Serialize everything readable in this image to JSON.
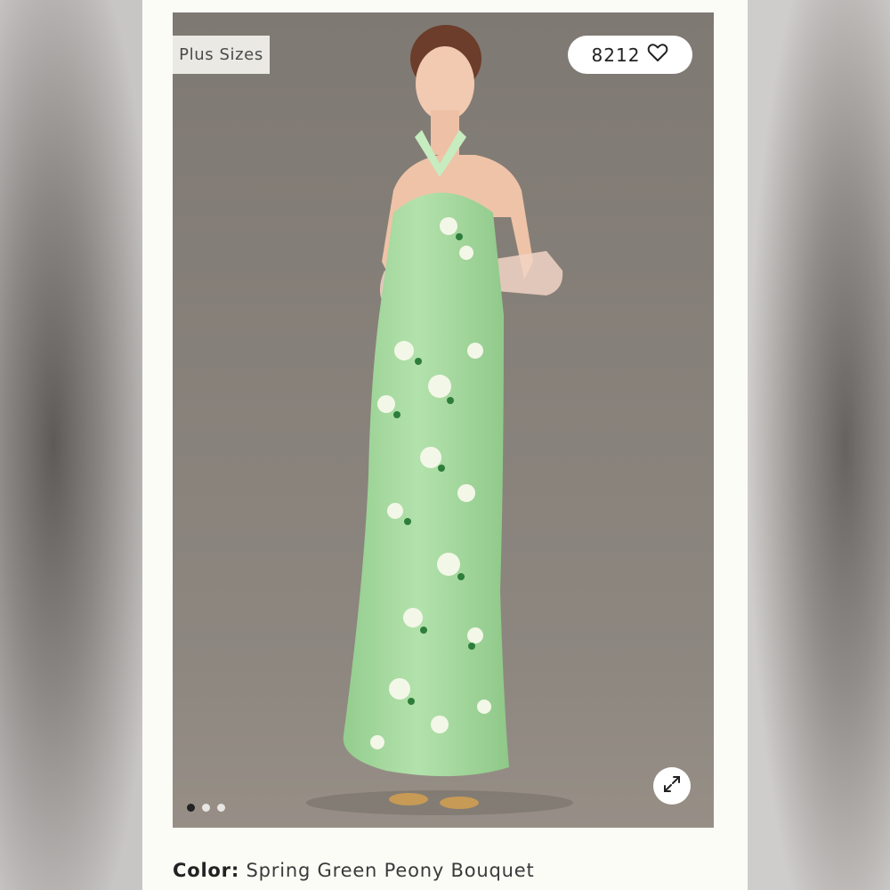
{
  "product": {
    "badge_label": "Plus Sizes",
    "like_count": "8212",
    "color_label": "Color:",
    "color_value": "Spring Green Peony Bouquet",
    "gallery": {
      "total_images": 3,
      "active_index": 0
    }
  },
  "icons": {
    "like": "heart-icon",
    "expand": "expand-icon"
  },
  "colors": {
    "card_bg": "#fcfcf7",
    "photo_bg": "#8a847d",
    "dress_green": "#a6d9a0"
  }
}
